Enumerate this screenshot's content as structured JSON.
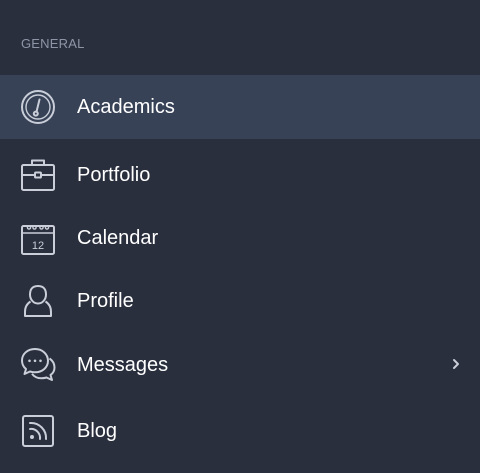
{
  "sidebar": {
    "section_title": "GENERAL",
    "active_item": "Academics",
    "items": [
      {
        "label": "Academics",
        "icon": "gauge-icon",
        "active": true
      },
      {
        "label": "Portfolio",
        "icon": "briefcase-icon",
        "active": false
      },
      {
        "label": "Calendar",
        "icon": "calendar-icon",
        "date_number": "12",
        "active": false
      },
      {
        "label": "Profile",
        "icon": "user-icon",
        "active": false
      },
      {
        "label": "Messages",
        "icon": "chat-bubbles-icon",
        "has_submenu": true,
        "active": false
      },
      {
        "label": "Blog",
        "icon": "rss-icon",
        "active": false
      }
    ]
  },
  "colors": {
    "background": "#2a2f3e",
    "active_background": "#374257",
    "section_title": "#8d95a6",
    "label": "#ffffff",
    "icon_stroke": "#c9ced8"
  }
}
